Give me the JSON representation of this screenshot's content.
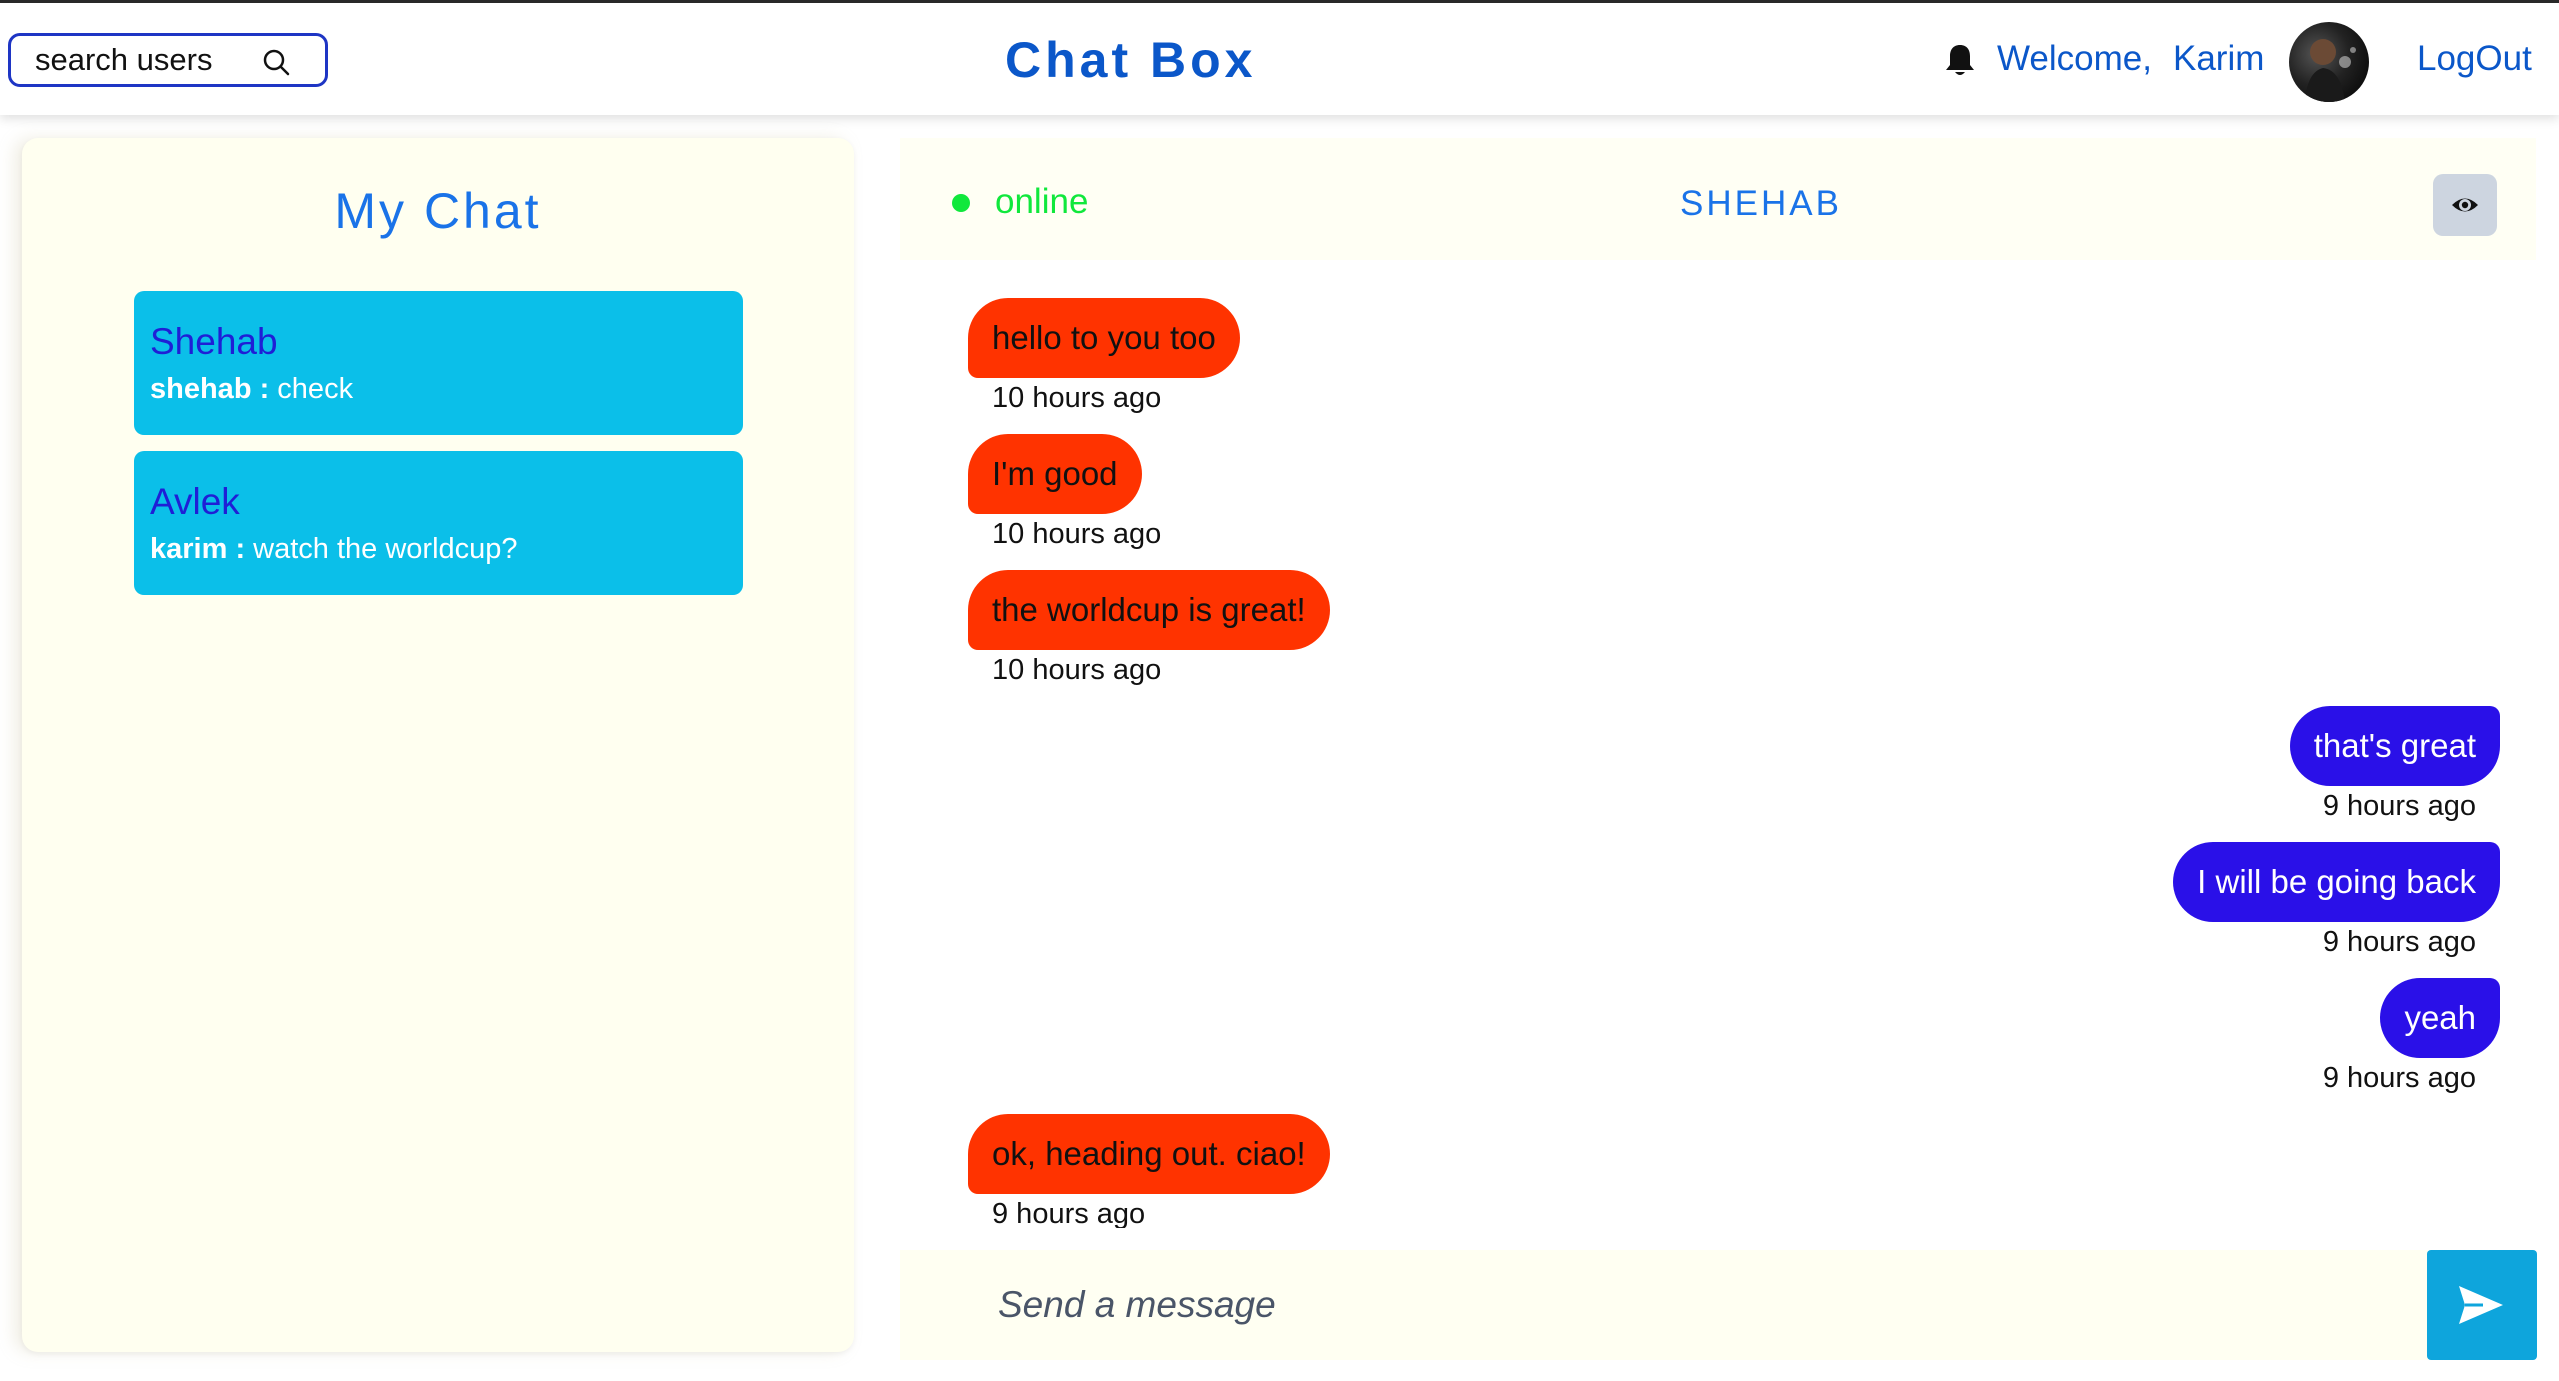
{
  "navbar": {
    "search_label": "search users",
    "brand": "Chat Box",
    "welcome": "Welcome,",
    "username": "Karim",
    "logout": "LogOut"
  },
  "sidebar": {
    "title": "My Chat",
    "chats": [
      {
        "name": "Shehab",
        "sender": "shehab :",
        "preview": " check"
      },
      {
        "name": "Avlek",
        "sender": "karim :",
        "preview": " watch the worldcup?"
      }
    ]
  },
  "chat": {
    "status": "online",
    "partner": "SHEHAB",
    "messages": [
      {
        "text": "hello to you too",
        "time": "10 hours ago",
        "direction": "in"
      },
      {
        "text": "I'm good",
        "time": "10 hours ago",
        "direction": "in"
      },
      {
        "text": "the worldcup is great!",
        "time": "10 hours ago",
        "direction": "in"
      },
      {
        "text": "that's great",
        "time": "9 hours ago",
        "direction": "out"
      },
      {
        "text": "I will be going back",
        "time": "9 hours ago",
        "direction": "out"
      },
      {
        "text": "yeah",
        "time": "9 hours ago",
        "direction": "out"
      },
      {
        "text": "ok, heading out. ciao!",
        "time": "9 hours ago",
        "direction": "in"
      }
    ],
    "composer_placeholder": "Send a message"
  },
  "colors": {
    "brand_blue": "#0b57c9",
    "incoming_bubble": "#ff3300",
    "outgoing_bubble": "#2a10e8",
    "chat_card": "#0bbfe9",
    "online": "#10e83c",
    "send_button": "#0ea5dc"
  },
  "icons": {
    "search": "search-icon",
    "bell": "bell-icon",
    "eye": "eye-icon",
    "send": "send-icon"
  }
}
